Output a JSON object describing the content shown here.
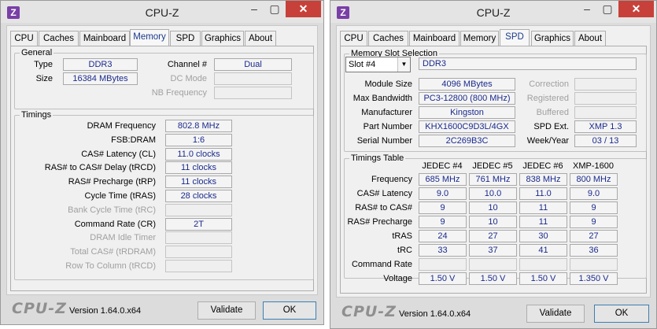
{
  "windows": [
    {
      "title": "CPU-Z",
      "close_glyph": "✕",
      "min_glyph": "‒",
      "max_glyph": "▢",
      "tabs": [
        "CPU",
        "Caches",
        "Mainboard",
        "Memory",
        "SPD",
        "Graphics",
        "About"
      ],
      "active_tab": "Memory",
      "general": {
        "title": "General",
        "type_label": "Type",
        "type_value": "DDR3",
        "size_label": "Size",
        "size_value": "16384 MBytes",
        "channel_label": "Channel #",
        "channel_value": "Dual",
        "dc_mode_label": "DC Mode",
        "dc_mode_value": "",
        "nb_freq_label": "NB Frequency",
        "nb_freq_value": ""
      },
      "timings": {
        "title": "Timings",
        "rows": [
          {
            "label": "DRAM Frequency",
            "value": "802.8 MHz",
            "enabled": true
          },
          {
            "label": "FSB:DRAM",
            "value": "1:6",
            "enabled": true
          },
          {
            "label": "CAS# Latency (CL)",
            "value": "11.0 clocks",
            "enabled": true
          },
          {
            "label": "RAS# to CAS# Delay (tRCD)",
            "value": "11 clocks",
            "enabled": true
          },
          {
            "label": "RAS# Precharge (tRP)",
            "value": "11 clocks",
            "enabled": true
          },
          {
            "label": "Cycle Time (tRAS)",
            "value": "28 clocks",
            "enabled": true
          },
          {
            "label": "Bank Cycle Time (tRC)",
            "value": "",
            "enabled": false
          },
          {
            "label": "Command Rate (CR)",
            "value": "2T",
            "enabled": true
          },
          {
            "label": "DRAM Idle Timer",
            "value": "",
            "enabled": false
          },
          {
            "label": "Total CAS# (tRDRAM)",
            "value": "",
            "enabled": false
          },
          {
            "label": "Row To Column (tRCD)",
            "value": "",
            "enabled": false
          }
        ]
      },
      "footer": {
        "logo": "CPU-Z",
        "version": "Version 1.64.0.x64",
        "validate": "Validate",
        "ok": "OK"
      }
    },
    {
      "title": "CPU-Z",
      "close_glyph": "✕",
      "min_glyph": "‒",
      "max_glyph": "▢",
      "tabs": [
        "CPU",
        "Caches",
        "Mainboard",
        "Memory",
        "SPD",
        "Graphics",
        "About"
      ],
      "active_tab": "SPD",
      "slot": {
        "title": "Memory Slot Selection",
        "selected_slot": "Slot #4",
        "type_value": "DDR3",
        "left_rows": [
          {
            "label": "Module Size",
            "value": "4096 MBytes"
          },
          {
            "label": "Max Bandwidth",
            "value": "PC3-12800 (800 MHz)"
          },
          {
            "label": "Manufacturer",
            "value": "Kingston"
          },
          {
            "label": "Part Number",
            "value": "KHX1600C9D3L/4GX"
          },
          {
            "label": "Serial Number",
            "value": "2C269B3C"
          }
        ],
        "right_rows": [
          {
            "label": "Correction",
            "value": "",
            "enabled": false
          },
          {
            "label": "Registered",
            "value": "",
            "enabled": false
          },
          {
            "label": "Buffered",
            "value": "",
            "enabled": false
          },
          {
            "label": "SPD Ext.",
            "value": "XMP 1.3",
            "enabled": true
          },
          {
            "label": "Week/Year",
            "value": "03 / 13",
            "enabled": true
          }
        ]
      },
      "timings_table": {
        "title": "Timings Table",
        "columns": [
          "JEDEC #4",
          "JEDEC #5",
          "JEDEC #6",
          "XMP-1600"
        ],
        "rows": [
          {
            "label": "Frequency",
            "values": [
              "685 MHz",
              "761 MHz",
              "838 MHz",
              "800 MHz"
            ]
          },
          {
            "label": "CAS# Latency",
            "values": [
              "9.0",
              "10.0",
              "11.0",
              "9.0"
            ]
          },
          {
            "label": "RAS# to CAS#",
            "values": [
              "9",
              "10",
              "11",
              "9"
            ]
          },
          {
            "label": "RAS# Precharge",
            "values": [
              "9",
              "10",
              "11",
              "9"
            ]
          },
          {
            "label": "tRAS",
            "values": [
              "24",
              "27",
              "30",
              "27"
            ]
          },
          {
            "label": "tRC",
            "values": [
              "33",
              "37",
              "41",
              "36"
            ]
          },
          {
            "label": "Command Rate",
            "values": [
              "",
              "",
              "",
              ""
            ]
          },
          {
            "label": "Voltage",
            "values": [
              "1.50 V",
              "1.50 V",
              "1.50 V",
              "1.350 V"
            ]
          }
        ]
      },
      "footer": {
        "logo": "CPU-Z",
        "version": "Version 1.64.0.x64",
        "validate": "Validate",
        "ok": "OK"
      }
    }
  ]
}
